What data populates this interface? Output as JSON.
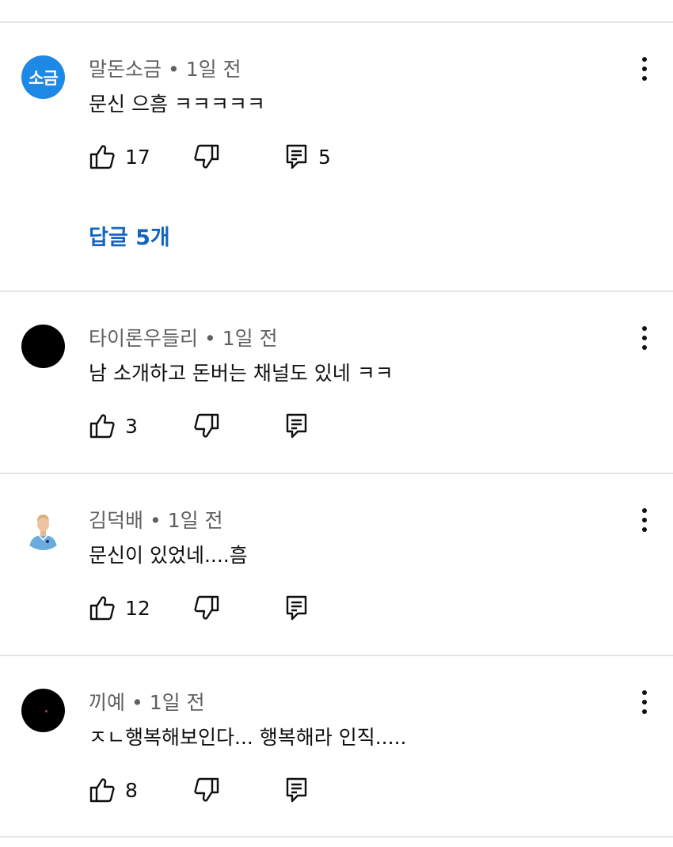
{
  "comments": [
    {
      "author": "말돈소금",
      "time": "1일 전",
      "text": "문신 으흠 ㅋㅋㅋㅋㅋ",
      "likes": "17",
      "reply_count": "5",
      "replies_link": "답글 5개",
      "avatar_text": "소금"
    },
    {
      "author": "타이론우들리",
      "time": "1일 전",
      "text": "남 소개하고 돈버는 채널도 있네 ㅋㅋ",
      "likes": "3",
      "reply_count": "",
      "replies_link": ""
    },
    {
      "author": "김덕배",
      "time": "1일 전",
      "text": "문신이 있었네....흠",
      "likes": "12",
      "reply_count": "",
      "replies_link": ""
    },
    {
      "author": "끼예",
      "time": "1일 전",
      "text": "ㅈㄴ행복해보인다... 행복해라 인직.....",
      "likes": "8",
      "reply_count": "",
      "replies_link": ""
    }
  ],
  "separator": "•",
  "icons": {
    "like": "thumbs-up-icon",
    "dislike": "thumbs-down-icon",
    "reply": "comment-reply-icon",
    "more": "more-vert-icon"
  },
  "colors": {
    "replies_link": "#1565c0",
    "avatar_blue": "#1e88e5",
    "meta_text": "#606060",
    "divider": "#e5e5e5"
  }
}
